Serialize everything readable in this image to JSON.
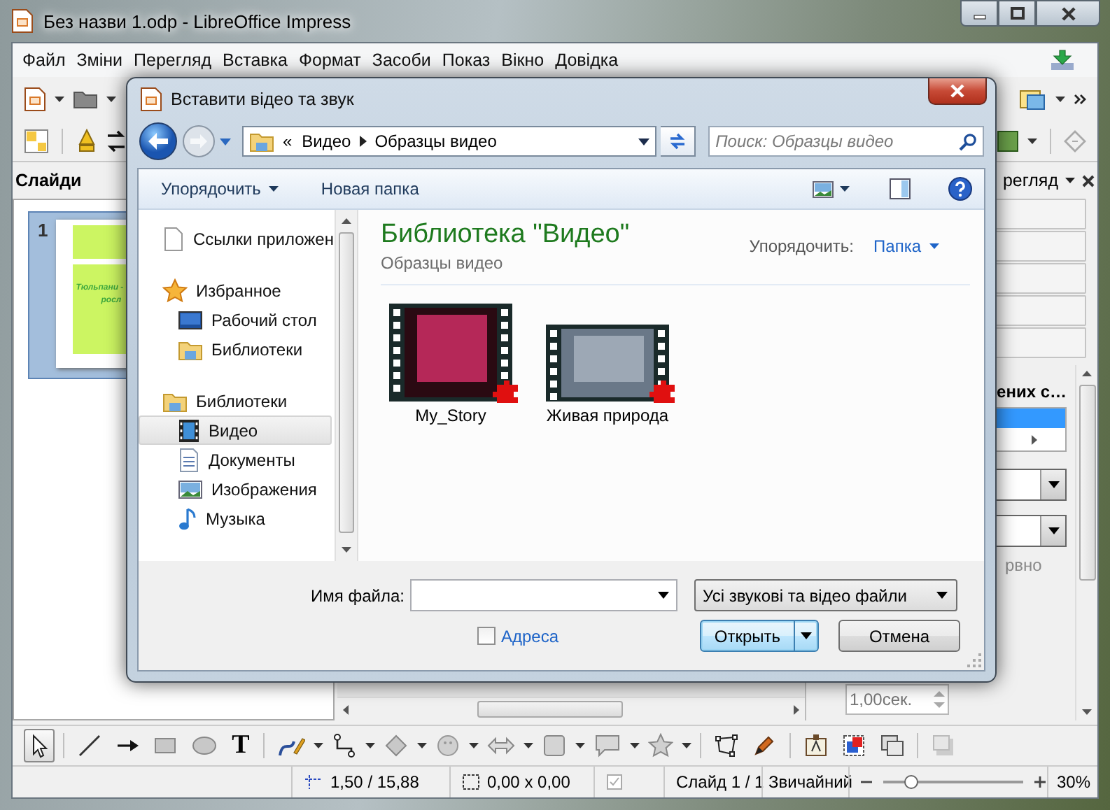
{
  "window": {
    "title": "Без назви 1.odp - LibreOffice Impress"
  },
  "menu": [
    "Файл",
    "Зміни",
    "Перегляд",
    "Вставка",
    "Формат",
    "Засоби",
    "Показ",
    "Вікно",
    "Довідка"
  ],
  "slides_panel": {
    "title": "Слайди",
    "slides": [
      {
        "number": "1",
        "selected": true,
        "text_lines": [
          "Тюльпани -",
          "росл"
        ]
      }
    ]
  },
  "tasks_panel": {
    "title": "регляд",
    "section": "ених с…",
    "option": "рвно",
    "duration": "1,00сек."
  },
  "draw_toolbar": {
    "tools": [
      {
        "kind": "select",
        "selected": true
      },
      {
        "kind": "line",
        "selected": false
      },
      {
        "kind": "arrow",
        "selected": false
      },
      {
        "kind": "rect",
        "selected": false
      },
      {
        "kind": "ellipse",
        "selected": false
      },
      {
        "kind": "text",
        "label": "T",
        "selected": false
      },
      {
        "kind": "curve",
        "selected": false
      },
      {
        "kind": "connector",
        "selected": false
      },
      {
        "kind": "diamond",
        "selected": false
      },
      {
        "kind": "smiley",
        "selected": false
      },
      {
        "kind": "double-arrow",
        "selected": false
      },
      {
        "kind": "flowchart",
        "selected": false
      },
      {
        "kind": "callout",
        "selected": false
      },
      {
        "kind": "star",
        "selected": false
      },
      {
        "kind": "points",
        "selected": false
      },
      {
        "kind": "pen",
        "selected": false
      },
      {
        "kind": "textbox",
        "selected": false
      },
      {
        "kind": "image",
        "selected": false
      },
      {
        "kind": "duplicate",
        "selected": false
      },
      {
        "kind": "shadow",
        "selected": false
      }
    ]
  },
  "status_bar": {
    "position": "1,50 / 15,88",
    "size": "0,00 x 0,00",
    "slide": "Слайд 1 / 1",
    "layout": "Звичайний",
    "zoom": {
      "level": 0.2,
      "reading": "30%"
    }
  },
  "dialog": {
    "title": "Вставити відео та звук",
    "address": {
      "overflow": "«",
      "path": [
        "Видео",
        "Образцы видео"
      ]
    },
    "search": {
      "placeholder": "Поиск: Образцы видео"
    },
    "toolbar": {
      "organize": "Упорядочить",
      "new_folder": "Новая папка"
    },
    "nav": [
      {
        "label": "Ссылки приложен",
        "kind": "document",
        "selected": false
      },
      {
        "label": "Избранное",
        "kind": "favorites",
        "selected": false,
        "children": [
          {
            "label": "Рабочий стол",
            "kind": "desktop",
            "selected": false
          },
          {
            "label": "Библиотеки",
            "kind": "library",
            "selected": false
          }
        ]
      },
      {
        "label": "Библиотеки",
        "kind": "library",
        "selected": false,
        "children": [
          {
            "label": "Видео",
            "kind": "video",
            "selected": true
          },
          {
            "label": "Документы",
            "kind": "documents",
            "selected": false
          },
          {
            "label": "Изображения",
            "kind": "pictures",
            "selected": false
          },
          {
            "label": "Музыка",
            "kind": "music",
            "selected": false
          }
        ]
      }
    ],
    "library": {
      "title": "Библиотека \"Видео\"",
      "subtitle": "Образцы видео",
      "arrange_label": "Упорядочить:",
      "arrange_value": "Папка"
    },
    "files": [
      {
        "name": "My_Story"
      },
      {
        "name": "Живая природа"
      }
    ],
    "file_name": {
      "label": "Имя файла:"
    },
    "file_type": "Усі звукові та відео файли",
    "address_option": {
      "label": "Адреса",
      "checked": false
    },
    "buttons": [
      {
        "label": "Открыть",
        "kind": "split",
        "default": true
      },
      {
        "label": "Отмена",
        "kind": "plain",
        "default": false
      }
    ]
  }
}
